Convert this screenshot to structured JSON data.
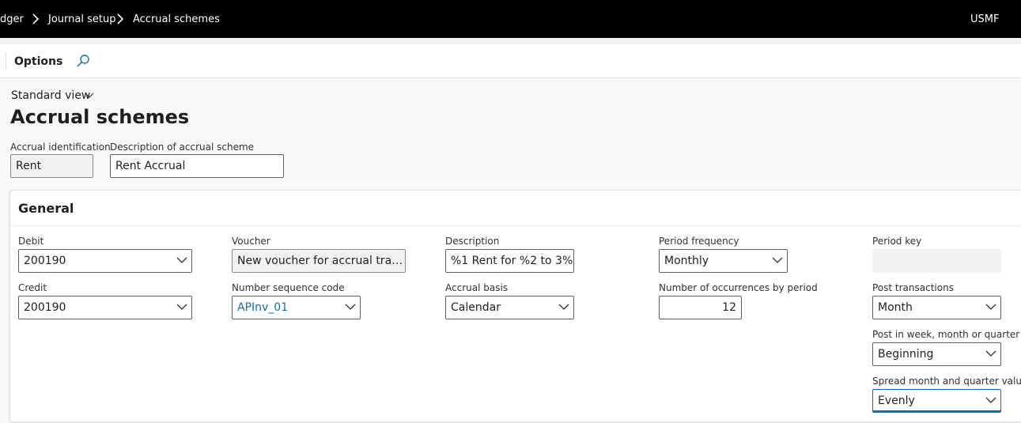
{
  "breadcrumb": {
    "items": [
      "dger",
      "Journal setup",
      "Accrual schemes"
    ]
  },
  "topbar": {
    "company": "USMF"
  },
  "actionbar": {
    "options_label": "Options"
  },
  "view": {
    "label": "Standard view"
  },
  "page": {
    "title": "Accrual schemes"
  },
  "header_fields": {
    "accrual_id": {
      "label": "Accrual identification",
      "value": "Rent"
    },
    "description": {
      "label": "Description of accrual scheme",
      "value": "Rent Accrual"
    }
  },
  "general": {
    "title": "General",
    "debit": {
      "label": "Debit",
      "value": "200190"
    },
    "credit": {
      "label": "Credit",
      "value": "200190"
    },
    "voucher": {
      "label": "Voucher",
      "value": "New voucher for accrual transac..."
    },
    "number_sequence": {
      "label": "Number sequence code",
      "value": "APInv_01"
    },
    "description": {
      "label": "Description",
      "value": "%1 Rent for %2 to 3%"
    },
    "accrual_basis": {
      "label": "Accrual basis",
      "value": "Calendar"
    },
    "period_frequency": {
      "label": "Period frequency",
      "value": "Monthly"
    },
    "occurrences": {
      "label": "Number of occurrences by period",
      "value": "12"
    },
    "period_key": {
      "label": "Period key",
      "value": ""
    },
    "post_transactions": {
      "label": "Post transactions",
      "value": "Month"
    },
    "post_in": {
      "label": "Post in week, month or quarter",
      "value": "Beginning"
    },
    "spread": {
      "label": "Spread month and quarter values",
      "value": "Evenly"
    }
  },
  "colors": {
    "topbar_bg": "#000000",
    "link": "#0f6cbd",
    "page_bg": "#faf9f8"
  }
}
